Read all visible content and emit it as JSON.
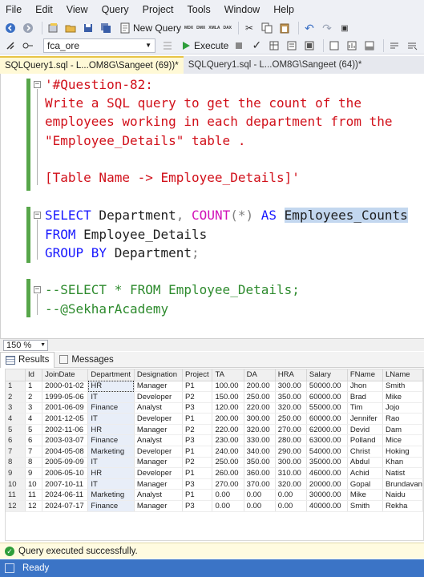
{
  "menu": [
    "File",
    "Edit",
    "View",
    "Query",
    "Project",
    "Tools",
    "Window",
    "Help"
  ],
  "toolbar": {
    "new_query_label": "New Query",
    "tiny_labels": [
      "MDX",
      "DMX",
      "XMLA",
      "DAX"
    ],
    "database": "fca_ore",
    "execute_label": "Execute"
  },
  "tabs": [
    {
      "label": "SQLQuery1.sql - L...OM8G\\Sangeet (69))*",
      "active": true
    },
    {
      "label": "SQLQuery1.sql - L...OM8G\\Sangeet (64))*",
      "active": false
    }
  ],
  "editor": {
    "comment_lines": [
      "'#Question-82:",
      "Write a SQL query to get the count of the",
      "employees working in each department from the",
      "\"Employee_Details\" table .",
      "",
      "[Table Name -> Employee_Details]'"
    ],
    "select_kw": "SELECT",
    "select_col": " Department",
    "comma": ",",
    "count_fn": "COUNT",
    "count_arg": "(*)",
    "as_kw": "AS",
    "alias": "Employees_Counts",
    "from_kw": "FROM",
    "from_table": " Employee_Details",
    "group_kw": "GROUP BY",
    "group_col": " Department",
    "semicolon": ";",
    "comment_select": "--SELECT * FROM Employee_Details;",
    "comment_academy": "--@SekharAcademy"
  },
  "zoom": "150 %",
  "results_tabs": {
    "results": "Results",
    "messages": "Messages"
  },
  "grid": {
    "columns": [
      "",
      "Id",
      "JoinDate",
      "Department",
      "Designation",
      "Project",
      "TA",
      "DA",
      "HRA",
      "Salary",
      "FName",
      "LName"
    ],
    "rows": [
      [
        "1",
        "1",
        "2000-01-02",
        "HR",
        "Manager",
        "P1",
        "100.00",
        "200.00",
        "300.00",
        "50000.00",
        "Jhon",
        "Smith"
      ],
      [
        "2",
        "2",
        "1999-05-06",
        "IT",
        "Developer",
        "P2",
        "150.00",
        "250.00",
        "350.00",
        "60000.00",
        "Brad",
        "Mike"
      ],
      [
        "3",
        "3",
        "2001-06-09",
        "Finance",
        "Analyst",
        "P3",
        "120.00",
        "220.00",
        "320.00",
        "55000.00",
        "Tim",
        "Jojo"
      ],
      [
        "4",
        "4",
        "2001-12-05",
        "IT",
        "Developer",
        "P1",
        "200.00",
        "300.00",
        "250.00",
        "60000.00",
        "Jennifer",
        "Rao"
      ],
      [
        "5",
        "5",
        "2002-11-06",
        "HR",
        "Manager",
        "P2",
        "220.00",
        "320.00",
        "270.00",
        "62000.00",
        "Devid",
        "Dam"
      ],
      [
        "6",
        "6",
        "2003-03-07",
        "Finance",
        "Analyst",
        "P3",
        "230.00",
        "330.00",
        "280.00",
        "63000.00",
        "Polland",
        "Mice"
      ],
      [
        "7",
        "7",
        "2004-05-08",
        "Marketing",
        "Developer",
        "P1",
        "240.00",
        "340.00",
        "290.00",
        "54000.00",
        "Christ",
        "Hoking"
      ],
      [
        "8",
        "8",
        "2005-09-09",
        "IT",
        "Manager",
        "P2",
        "250.00",
        "350.00",
        "300.00",
        "35000.00",
        "Abdul",
        "Khan"
      ],
      [
        "9",
        "9",
        "2006-05-10",
        "HR",
        "Developer",
        "P1",
        "260.00",
        "360.00",
        "310.00",
        "46000.00",
        "Achid",
        "Natist"
      ],
      [
        "10",
        "10",
        "2007-10-11",
        "IT",
        "Manager",
        "P3",
        "270.00",
        "370.00",
        "320.00",
        "20000.00",
        "Gopal",
        "Brundavan"
      ],
      [
        "11",
        "11",
        "2024-06-11",
        "Marketing",
        "Analyst",
        "P1",
        "0.00",
        "0.00",
        "0.00",
        "30000.00",
        "Mike",
        "Naidu"
      ],
      [
        "12",
        "12",
        "2024-07-17",
        "Finance",
        "Manager",
        "P3",
        "0.00",
        "0.00",
        "0.00",
        "40000.00",
        "Smith",
        "Rekha"
      ]
    ]
  },
  "status": "Query executed successfully.",
  "ready": "Ready"
}
